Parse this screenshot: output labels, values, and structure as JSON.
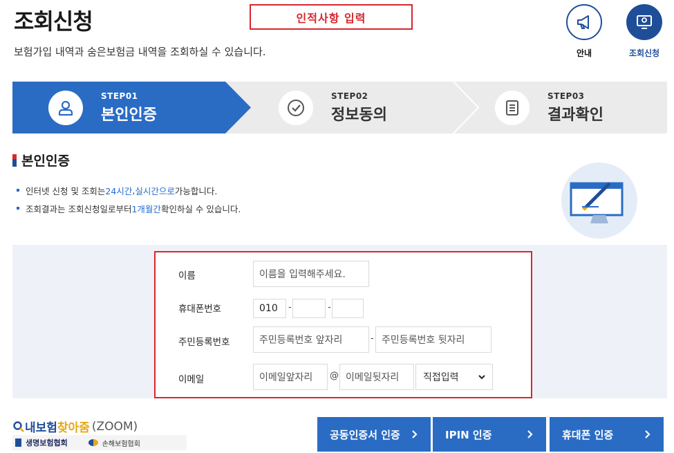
{
  "header": {
    "title": "조회신청",
    "subtitle": "보험가입 내역과 숨은보험금 내역을 조회하실 수 있습니다.",
    "annotation": "인적사항 입력",
    "actions": [
      {
        "label": "안내",
        "icon": "megaphone-icon"
      },
      {
        "label": "조회신청",
        "icon": "monitor-icon"
      }
    ]
  },
  "steps": [
    {
      "num": "STEP01",
      "name": "본인인증",
      "icon": "person-icon",
      "active": true
    },
    {
      "num": "STEP02",
      "name": "정보동의",
      "icon": "check-icon",
      "active": false
    },
    {
      "num": "STEP03",
      "name": "결과확인",
      "icon": "document-icon",
      "active": false
    }
  ],
  "section": {
    "title": "본인인증",
    "bullet1": {
      "pre": "인터넷 신청 및 조회는 ",
      "hl1": "24시간",
      "mid": ", ",
      "hl2": "실시간으로",
      "post": " 가능합니다."
    },
    "bullet2": {
      "pre": "조회결과는 조회신청일로부터 ",
      "hl": "1개월간",
      "post": " 확인하실 수 있습니다."
    }
  },
  "form": {
    "name_label": "이름",
    "name_placeholder": "이름을 입력해주세요.",
    "phone_label": "휴대폰번호",
    "phone_prefix": "010",
    "phone_sep": "-",
    "rrn_label": "주민등록번호",
    "rrn_front_placeholder": "주민등록번호 앞자리",
    "rrn_sep": "-",
    "rrn_back_placeholder": "주민등록번호 뒷자리",
    "email_label": "이메일",
    "email_front_placeholder": "이메일앞자리",
    "email_at": "@",
    "email_back_placeholder": "이메일뒷자리",
    "email_domain_selected": "직접입력"
  },
  "footer": {
    "zoom_main": "내보험 ",
    "zoom_accent": "찾아줌",
    "zoom_en": "(ZOOM)",
    "assoc1": "생명보험협회",
    "assoc2": "손해보험협회",
    "buttons": [
      "공동인증서 인증",
      "IPIN 인증",
      "휴대폰 인증"
    ]
  },
  "colors": {
    "brand": "#2a6cc4",
    "navy": "#1f4e99",
    "highlight": "#d7262c"
  }
}
